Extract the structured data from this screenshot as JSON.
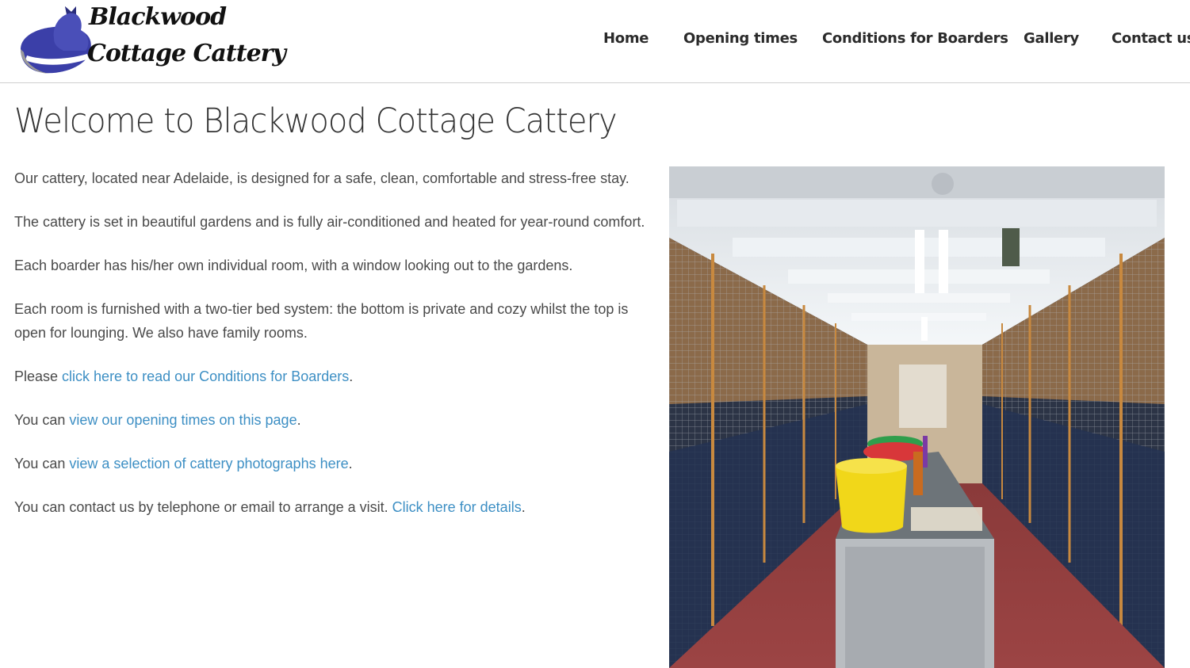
{
  "site": {
    "logo_line1": "Blackwood",
    "logo_line2": "Cottage Cattery",
    "logo_icon": "cat-silhouette-icon"
  },
  "nav": {
    "items": [
      {
        "label": "Home"
      },
      {
        "label": "Opening times"
      },
      {
        "label": "Conditions for Boarders"
      },
      {
        "label": "Gallery"
      },
      {
        "label": "Contact us"
      }
    ]
  },
  "page": {
    "title": "Welcome to Blackwood Cottage Cattery",
    "p1": "Our cattery, located near Adelaide, is designed for a safe, clean, comfortable and stress-free stay.",
    "p2": "The cattery is set in beautiful gardens and is fully air-conditioned and heated for year-round comfort.",
    "p3": "Each boarder has his/her own individual room, with a window looking out to the gardens.",
    "p4": "Each room is furnished with a two-tier bed system: the bottom is private and cozy whilst the top is open for lounging. We also have family rooms.",
    "p5_prefix": "Please ",
    "p5_link": "click here to read our Conditions for Boarders",
    "p5_suffix": ".",
    "p6_prefix": "You can ",
    "p6_link": "view our opening times on this page",
    "p6_suffix": ".",
    "p7_prefix": "You can ",
    "p7_link": "view a selection of cattery photographs here",
    "p7_suffix": ".",
    "p8_prefix": "You can contact us by telephone or email to arrange a visit. ",
    "p8_link": "Click here for details",
    "p8_suffix": "."
  },
  "colors": {
    "link": "#3d8fc4",
    "logo_blue": "#3b3fa8",
    "header_border": "#cfcfcf"
  }
}
